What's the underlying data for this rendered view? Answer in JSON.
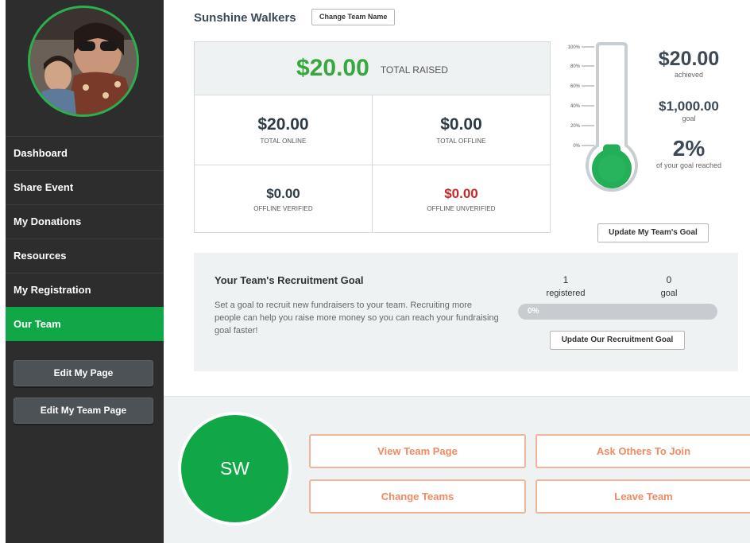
{
  "sidebar": {
    "items": [
      {
        "label": "Dashboard"
      },
      {
        "label": "Share Event"
      },
      {
        "label": "My Donations"
      },
      {
        "label": "Resources"
      },
      {
        "label": "My Registration"
      },
      {
        "label": "Our Team"
      }
    ],
    "active_item": "Our Team",
    "edit_page_label": "Edit My Page",
    "edit_team_page_label": "Edit My Team Page"
  },
  "team": {
    "name": "Sunshine Walkers",
    "change_name_label": "Change Team Name"
  },
  "totals": {
    "total_raised": "$20.00",
    "total_raised_label": "TOTAL RAISED",
    "total_online": "$20.00",
    "total_online_label": "TOTAL ONLINE",
    "total_offline": "$0.00",
    "total_offline_label": "TOTAL OFFLINE",
    "offline_verified": "$0.00",
    "offline_verified_label": "OFFLINE VERIFIED",
    "offline_unverified": "$0.00",
    "offline_unverified_label": "OFFLINE UNVERIFIED"
  },
  "goal": {
    "achieved_amount": "$20.00",
    "achieved_label": "achieved",
    "goal_amount": "$1,000.00",
    "goal_label": "goal",
    "percent": "2%",
    "percent_label": "of your goal reached",
    "percent_value": 2,
    "scale_ticks": [
      "100%",
      "80%",
      "60%",
      "40%",
      "20%",
      "0%"
    ],
    "update_button_label": "Update My Team's Goal"
  },
  "recruitment": {
    "title": "Your Team's Recruitment Goal",
    "description": "Set a goal to recruit new fundraisers to your team. Recruiting more people can help you raise more money so you can reach your fundraising goal faster!",
    "registered_count": "1",
    "registered_label": "registered",
    "goal_count": "0",
    "goal_label": "goal",
    "progress_text": "0%",
    "progress_value": 0,
    "update_button_label": "Update Our Recruitment Goal"
  },
  "actions": {
    "initials": "SW",
    "view_team_page": "View Team Page",
    "ask_others": "Ask Others To Join",
    "change_teams": "Change Teams",
    "leave_team": "Leave Team"
  },
  "colors": {
    "accent_green": "#10a847",
    "amount_green": "#36a83e",
    "unverified_red": "#c42a2a",
    "action_orange": "#f08a60"
  }
}
